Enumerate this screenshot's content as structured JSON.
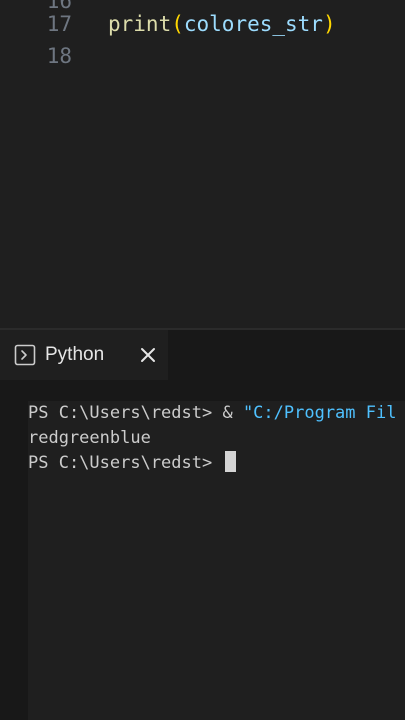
{
  "editor": {
    "lines": [
      {
        "number": "16",
        "code": ""
      },
      {
        "number": "17",
        "func": "print",
        "open": "(",
        "arg": "colores_str",
        "close": ")"
      },
      {
        "number": "18",
        "code": ""
      }
    ]
  },
  "terminal": {
    "tab": {
      "icon": "terminal-icon",
      "label": "Python",
      "close_icon": "close-icon"
    },
    "lines": [
      {
        "prompt": "PS C:\\Users\\redst> & ",
        "string": "\"C:/Program Fil"
      },
      {
        "text": "redgreenblue"
      },
      {
        "prompt": "PS C:\\Users\\redst> "
      }
    ]
  },
  "colors": {
    "editor_bg": "#1f1f1f",
    "terminal_bg": "#181818",
    "function": "#dcdcaa",
    "bracket": "#ffd700",
    "variable": "#9cdcfe",
    "string": "#4fc1ff",
    "line_number": "#6e7681"
  }
}
